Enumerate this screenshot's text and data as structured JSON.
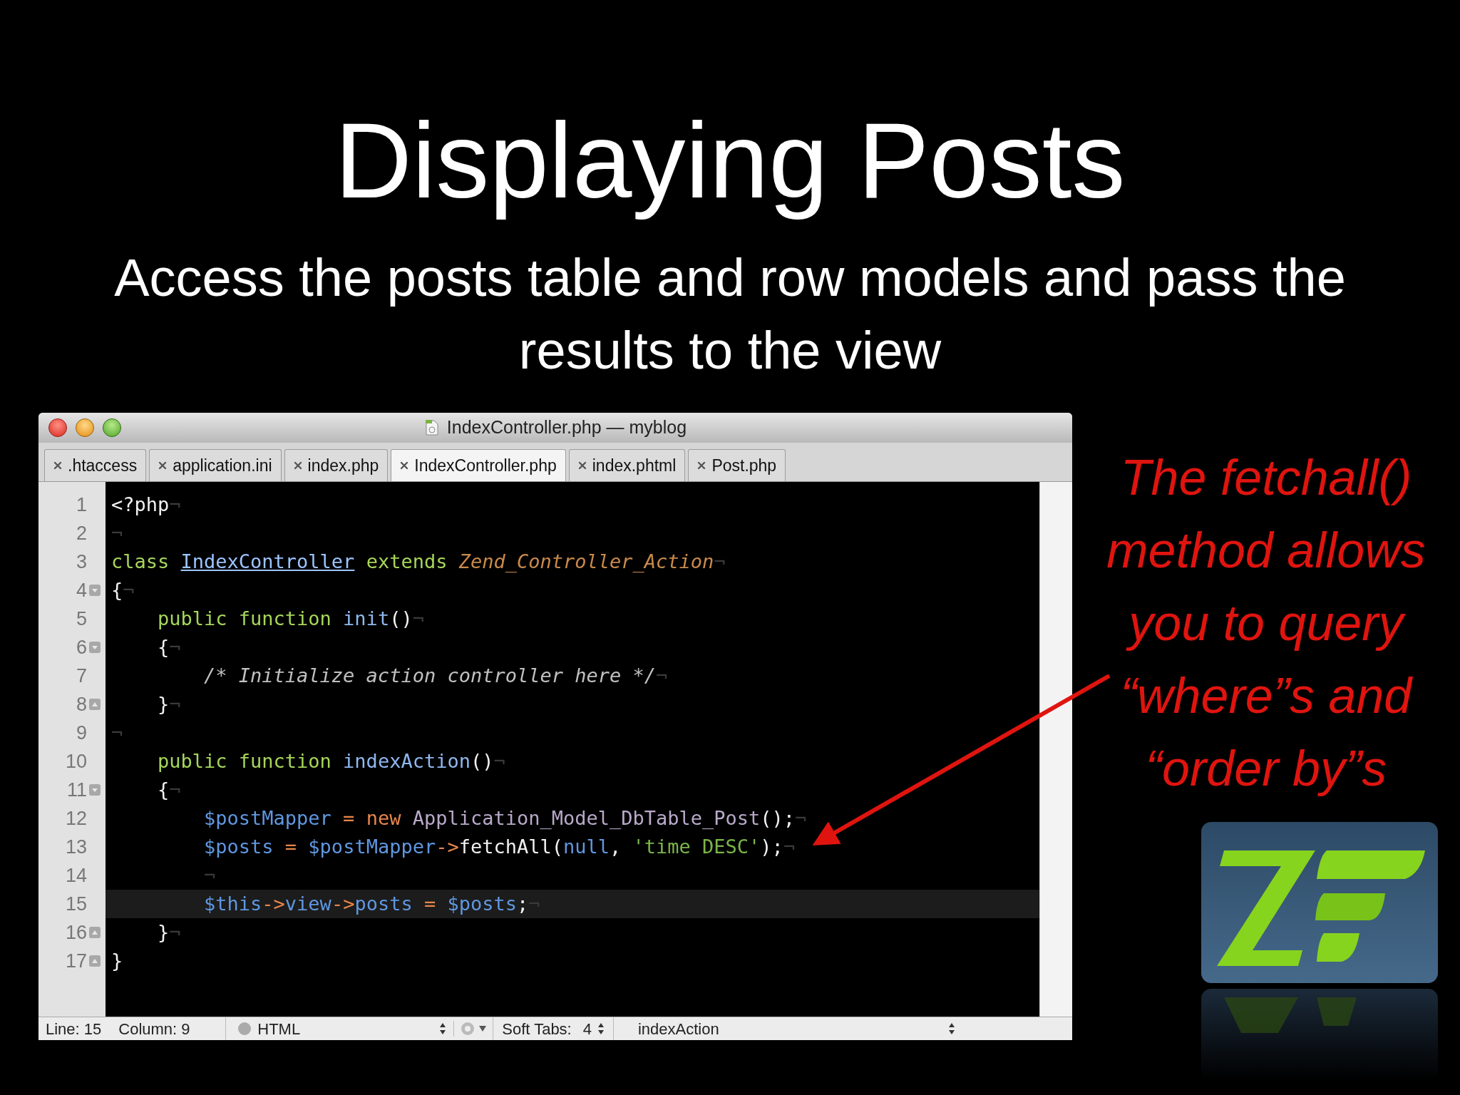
{
  "slide": {
    "title": "Displaying Posts",
    "subtitle": "Access the posts table and row models and pass the results to the view",
    "annotation": "The fetchall()\nmethod allows\nyou to query\n“where”s and\n“order by”s"
  },
  "window": {
    "title": "IndexController.php — myblog"
  },
  "tabs": [
    {
      "label": ".htaccess",
      "selected": false
    },
    {
      "label": "application.ini",
      "selected": false
    },
    {
      "label": "index.php",
      "selected": false
    },
    {
      "label": "IndexController.php",
      "selected": true
    },
    {
      "label": "index.phtml",
      "selected": false
    },
    {
      "label": "Post.php",
      "selected": false
    }
  ],
  "code": [
    {
      "number": "1",
      "kind": "plain",
      "current": false,
      "tokens": [
        {
          "text": "<?php",
          "kind": "plain"
        },
        {
          "text": "¬",
          "kind": "invisible"
        }
      ]
    },
    {
      "number": "2",
      "kind": "plain",
      "current": false,
      "tokens": [
        {
          "text": "¬",
          "kind": "invisible"
        }
      ]
    },
    {
      "number": "3",
      "kind": "plain",
      "current": false,
      "tokens": [
        {
          "text": "class ",
          "kind": "keyword"
        },
        {
          "text": "IndexController",
          "kind": "classname"
        },
        {
          "text": " extends ",
          "kind": "keyword"
        },
        {
          "text": "Zend_Controller_Action",
          "kind": "parent"
        },
        {
          "text": "¬",
          "kind": "invisible"
        }
      ]
    },
    {
      "number": "4",
      "kind": "fold-start",
      "current": false,
      "tokens": [
        {
          "text": "{",
          "kind": "plain"
        },
        {
          "text": "¬",
          "kind": "invisible"
        }
      ]
    },
    {
      "number": "5",
      "kind": "plain",
      "current": false,
      "tokens": [
        {
          "text": "    public function ",
          "kind": "keyword"
        },
        {
          "text": "init",
          "kind": "function"
        },
        {
          "text": "()",
          "kind": "plain"
        },
        {
          "text": "¬",
          "kind": "invisible"
        }
      ]
    },
    {
      "number": "6",
      "kind": "fold-start",
      "current": false,
      "tokens": [
        {
          "text": "    {",
          "kind": "plain"
        },
        {
          "text": "¬",
          "kind": "invisible"
        }
      ]
    },
    {
      "number": "7",
      "kind": "plain",
      "current": false,
      "tokens": [
        {
          "text": "        /* Initialize action controller here */",
          "kind": "comment"
        },
        {
          "text": "¬",
          "kind": "invisible"
        }
      ]
    },
    {
      "number": "8",
      "kind": "fold-end",
      "current": false,
      "tokens": [
        {
          "text": "    }",
          "kind": "plain"
        },
        {
          "text": "¬",
          "kind": "invisible"
        }
      ]
    },
    {
      "number": "9",
      "kind": "plain",
      "current": false,
      "tokens": [
        {
          "text": "¬",
          "kind": "invisible"
        }
      ]
    },
    {
      "number": "10",
      "kind": "plain",
      "current": false,
      "tokens": [
        {
          "text": "    public function ",
          "kind": "keyword"
        },
        {
          "text": "indexAction",
          "kind": "function"
        },
        {
          "text": "()",
          "kind": "plain"
        },
        {
          "text": "¬",
          "kind": "invisible"
        }
      ]
    },
    {
      "number": "11",
      "kind": "fold-start",
      "current": false,
      "tokens": [
        {
          "text": "    {",
          "kind": "plain"
        },
        {
          "text": "¬",
          "kind": "invisible"
        }
      ]
    },
    {
      "number": "12",
      "kind": "plain",
      "current": false,
      "tokens": [
        {
          "text": "        $postMapper",
          "kind": "variable"
        },
        {
          "text": " = new ",
          "kind": "operator"
        },
        {
          "text": "Application_Model_DbTable_Post",
          "kind": "support"
        },
        {
          "text": "();",
          "kind": "plain"
        },
        {
          "text": "¬",
          "kind": "invisible"
        }
      ]
    },
    {
      "number": "13",
      "kind": "plain",
      "current": false,
      "tokens": [
        {
          "text": "        $posts",
          "kind": "variable"
        },
        {
          "text": " = ",
          "kind": "operator"
        },
        {
          "text": "$postMapper",
          "kind": "variable"
        },
        {
          "text": "->",
          "kind": "operator"
        },
        {
          "text": "fetchAll(",
          "kind": "plain"
        },
        {
          "text": "null",
          "kind": "variable"
        },
        {
          "text": ", ",
          "kind": "plain"
        },
        {
          "text": "'time DESC'",
          "kind": "string"
        },
        {
          "text": ");",
          "kind": "plain"
        },
        {
          "text": "¬",
          "kind": "invisible"
        }
      ]
    },
    {
      "number": "14",
      "kind": "plain",
      "current": false,
      "tokens": [
        {
          "text": "        ¬",
          "kind": "invisible"
        }
      ]
    },
    {
      "number": "15",
      "kind": "plain",
      "current": true,
      "tokens": [
        {
          "text": "        $this",
          "kind": "variable"
        },
        {
          "text": "->",
          "kind": "operator"
        },
        {
          "text": "view",
          "kind": "variable"
        },
        {
          "text": "->",
          "kind": "operator"
        },
        {
          "text": "posts",
          "kind": "variable"
        },
        {
          "text": " = ",
          "kind": "operator"
        },
        {
          "text": "$posts",
          "kind": "variable"
        },
        {
          "text": ";",
          "kind": "plain"
        },
        {
          "text": "¬",
          "kind": "invisible"
        }
      ]
    },
    {
      "number": "16",
      "kind": "fold-end",
      "current": false,
      "tokens": [
        {
          "text": "    }",
          "kind": "plain"
        },
        {
          "text": "¬",
          "kind": "invisible"
        }
      ]
    },
    {
      "number": "17",
      "kind": "fold-end",
      "current": false,
      "tokens": [
        {
          "text": "}",
          "kind": "plain"
        }
      ]
    }
  ],
  "status_bar": {
    "line": "Line: 15",
    "column": "Column: 9",
    "language": "HTML",
    "soft_tabs_label": "Soft Tabs:",
    "soft_tabs_value": "4",
    "symbol": "indexAction"
  }
}
